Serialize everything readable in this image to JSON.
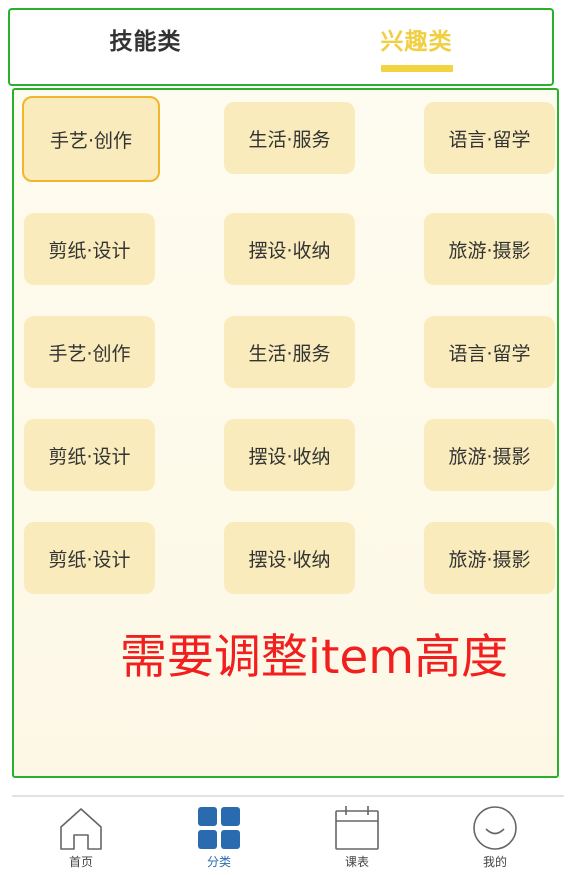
{
  "tabs": [
    {
      "label": "技能类",
      "active": false
    },
    {
      "label": "兴趣类",
      "active": true
    }
  ],
  "items": [
    "手艺·创作",
    "生活·服务",
    "语言·留学",
    "剪纸·设计",
    "摆设·收纳",
    "旅游·摄影",
    "手艺·创作",
    "生活·服务",
    "语言·留学",
    "剪纸·设计",
    "摆设·收纳",
    "旅游·摄影",
    "剪纸·设计",
    "摆设·收纳",
    "旅游·摄影"
  ],
  "annotation": "需要调整item高度",
  "nav": [
    {
      "label": "首页",
      "icon": "home-icon"
    },
    {
      "label": "分类",
      "icon": "category-icon",
      "active": true
    },
    {
      "label": "课表",
      "icon": "calendar-icon"
    },
    {
      "label": "我的",
      "icon": "profile-icon"
    }
  ],
  "colors": {
    "accent": "#f2d442",
    "frame": "#2bb02b",
    "item_bg": "#f9ebbb",
    "annotation": "#f21f1f",
    "nav_active": "#2a6bb0"
  }
}
